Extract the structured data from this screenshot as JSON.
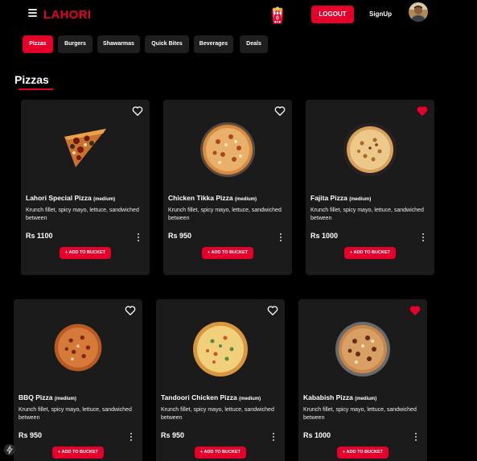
{
  "navbar": {
    "brand": "LAHORI",
    "bucket_count": "0",
    "logout_label": "LOGOUT",
    "signup_label": "SignUp"
  },
  "categories": [
    {
      "label": "Pizzas",
      "active": true
    },
    {
      "label": "Burgers",
      "active": false
    },
    {
      "label": "Shawarmas",
      "active": false
    },
    {
      "label": "Quick Bites",
      "active": false
    },
    {
      "label": "Beverages",
      "active": false
    },
    {
      "label": "Deals",
      "active": false
    }
  ],
  "section": {
    "title": "Pizzas"
  },
  "products": [
    {
      "name": "Lahori Special Pizza",
      "size": "(medium)",
      "desc": "Krunch fillet, spicy mayo, lettuce, sandwiched between",
      "price": "Rs 1100",
      "add_label": "+ ADD TO BUCKET",
      "favorite": false
    },
    {
      "name": "Chicken Tikka Pizza",
      "size": "(medium)",
      "desc": "Krunch fillet, spicy mayo, lettuce, sandwiched between",
      "price": "Rs 950",
      "add_label": "+ ADD TO BUCKET",
      "favorite": false
    },
    {
      "name": "Fajita Pizza",
      "size": "(medium)",
      "desc": "Krunch fillet, spicy mayo, lettuce, sandwiched between",
      "price": "Rs 1000",
      "add_label": "+ ADD TO BUCKET",
      "favorite": true
    },
    {
      "name": "BBQ Pizza",
      "size": "(medium)",
      "desc": "Krunch fillet, spicy mayo, lettuce, sandwiched between",
      "price": "Rs 950",
      "add_label": "+ ADD TO BUCKET",
      "favorite": false
    },
    {
      "name": "Tandoori Chicken Pizza",
      "size": "(medium)",
      "desc": "Krunch fillet, spicy mayo, lettuce, sandwiched between",
      "price": "Rs 950",
      "add_label": "+ ADD TO BUCKET",
      "favorite": false
    },
    {
      "name": "Kababish Pizza",
      "size": "(medium)",
      "desc": "Krunch fillet, spicy mayo, lettuce, sandwiched between",
      "price": "Rs 1000",
      "add_label": "+ ADD TO BUCKET",
      "favorite": true
    }
  ],
  "colors": {
    "accent": "#e4002b",
    "card_bg": "#1c1b1b",
    "page_bg": "#000000"
  }
}
